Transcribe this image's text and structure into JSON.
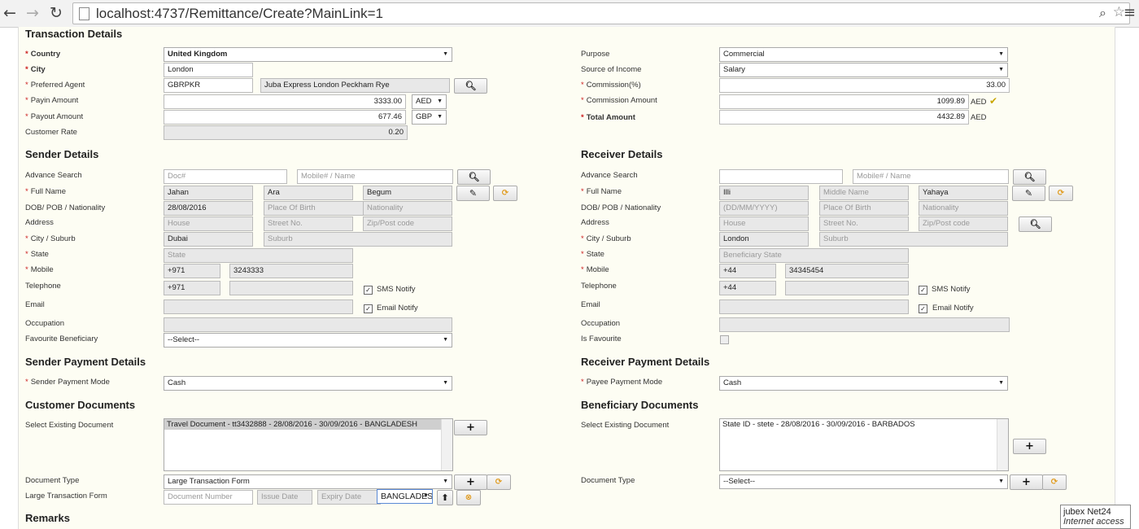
{
  "browser": {
    "url": "localhost:4737/Remittance/Create?MainLink=1"
  },
  "transaction": {
    "heading": "Transaction Details",
    "country_label": "Country",
    "country": "United Kingdom",
    "city_label": "City",
    "city": "London",
    "agent_label": "Preferred Agent",
    "agent_code": "GBRPKR",
    "agent_name": "Juba Express London Peckham Rye",
    "payin_label": "Payin Amount",
    "payin_amount": "3333.00",
    "payin_currency": "AED",
    "payout_label": "Payout Amount",
    "payout_amount": "677.46",
    "payout_currency": "GBP",
    "rate_label": "Customer Rate",
    "rate": "0.20",
    "purpose_label": "Purpose",
    "purpose": "Commercial",
    "income_label": "Source of Income",
    "income": "Salary",
    "commission_pct_label": "Commission(%)",
    "commission_pct": "33.00",
    "commission_amt_label": "Commission Amount",
    "commission_amt": "1099.89",
    "commission_currency": "AED",
    "total_label": "Total Amount",
    "total": "4432.89",
    "total_currency": "AED"
  },
  "sender": {
    "heading": "Sender Details",
    "adv_label": "Advance Search",
    "doc_placeholder": "Doc#",
    "mobile_name_placeholder": "Mobile# / Name",
    "fullname_label": "Full Name",
    "first": "Jahan",
    "middle": "Ara",
    "last": "Begum",
    "dob_label": "DOB/ POB / Nationality",
    "dob": "28/08/2016",
    "pob_placeholder": "Place Of Birth",
    "nat_placeholder": "Nationality",
    "address_label": "Address",
    "house_placeholder": "House",
    "street_placeholder": "Street No.",
    "zip_placeholder": "Zip/Post code",
    "city_label": "City / Suburb",
    "city": "Dubai",
    "suburb_placeholder": "Suburb",
    "state_label": "State",
    "state_placeholder": "State",
    "mobile_label": "Mobile",
    "mobile_code": "+971",
    "mobile": "3243333",
    "tel_label": "Telephone",
    "tel_code": "+971",
    "sms_label": "SMS Notify",
    "email_label": "Email",
    "email_notify_label": "Email Notify",
    "occupation_label": "Occupation",
    "fav_label": "Favourite Beneficiary",
    "fav_value": "--Select--"
  },
  "receiver": {
    "heading": "Receiver Details",
    "adv_label": "Advance Search",
    "mobile_name_placeholder": "Mobile# / Name",
    "fullname_label": "Full Name",
    "first": "Illi",
    "middle_placeholder": "Middle Name",
    "last": "Yahaya",
    "dob_label": "DOB/ POB / Nationality",
    "dob_placeholder": "(DD/MM/YYYY)",
    "pob_placeholder": "Place Of Birth",
    "nat_placeholder": "Nationality",
    "address_label": "Address",
    "house_placeholder": "House",
    "street_placeholder": "Street No.",
    "zip_placeholder": "Zip/Post code",
    "city_label": "City / Suburb",
    "city": "London",
    "suburb_placeholder": "Suburb",
    "state_label": "State",
    "state_placeholder": "Beneficiary State",
    "mobile_label": "Mobile",
    "mobile_code": "+44",
    "mobile": "34345454",
    "tel_label": "Telephone",
    "tel_code": "+44",
    "sms_label": "SMS Notify",
    "email_label": "Email",
    "email_notify_label": "Email Notify",
    "occupation_label": "Occupation",
    "fav_label": "Is Favourite"
  },
  "sender_payment": {
    "heading": "Sender Payment Details",
    "mode_label": "Sender Payment Mode",
    "mode": "Cash"
  },
  "receiver_payment": {
    "heading": "Receiver Payment Details",
    "mode_label": "Payee Payment Mode",
    "mode": "Cash"
  },
  "customer_docs": {
    "heading": "Customer Documents",
    "existing_label": "Select Existing Document",
    "existing_item": "Travel Document - tt3432888 - 28/08/2016 - 30/09/2016 - BANGLADESH",
    "type_label": "Document Type",
    "type_value": "Large Transaction Form",
    "ltf_label": "Large Transaction Form",
    "doc_number_placeholder": "Document Number",
    "issue_placeholder": "Issue Date",
    "expiry_placeholder": "Expiry Date",
    "country_value": "BANGLADESH"
  },
  "beneficiary_docs": {
    "heading": "Beneficiary Documents",
    "existing_label": "Select Existing Document",
    "existing_item": "State ID - stete - 28/08/2016 - 30/09/2016 - BARBADOS",
    "type_label": "Document Type",
    "type_value": "--Select--"
  },
  "remarks": {
    "heading": "Remarks"
  },
  "tooltip": {
    "title": "jubex Net24",
    "subtitle": "Internet access"
  },
  "colors": {
    "page_bg": "#fdfdf3",
    "required": "#cc1f1f",
    "readonly_bg": "#e8e8e8",
    "accent_orange": "#e09a1c"
  }
}
